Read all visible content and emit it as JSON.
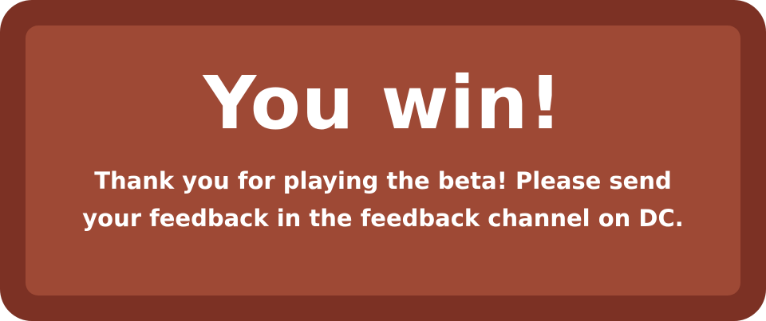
{
  "dialog": {
    "title": "You win!",
    "message_lines": [
      "Thank you for playing the beta! Please send",
      "your feedback in the feedback channel on DC."
    ]
  },
  "colors": {
    "frame": "#7c3124",
    "panel": "#9e4935",
    "text": "#ffffff"
  }
}
